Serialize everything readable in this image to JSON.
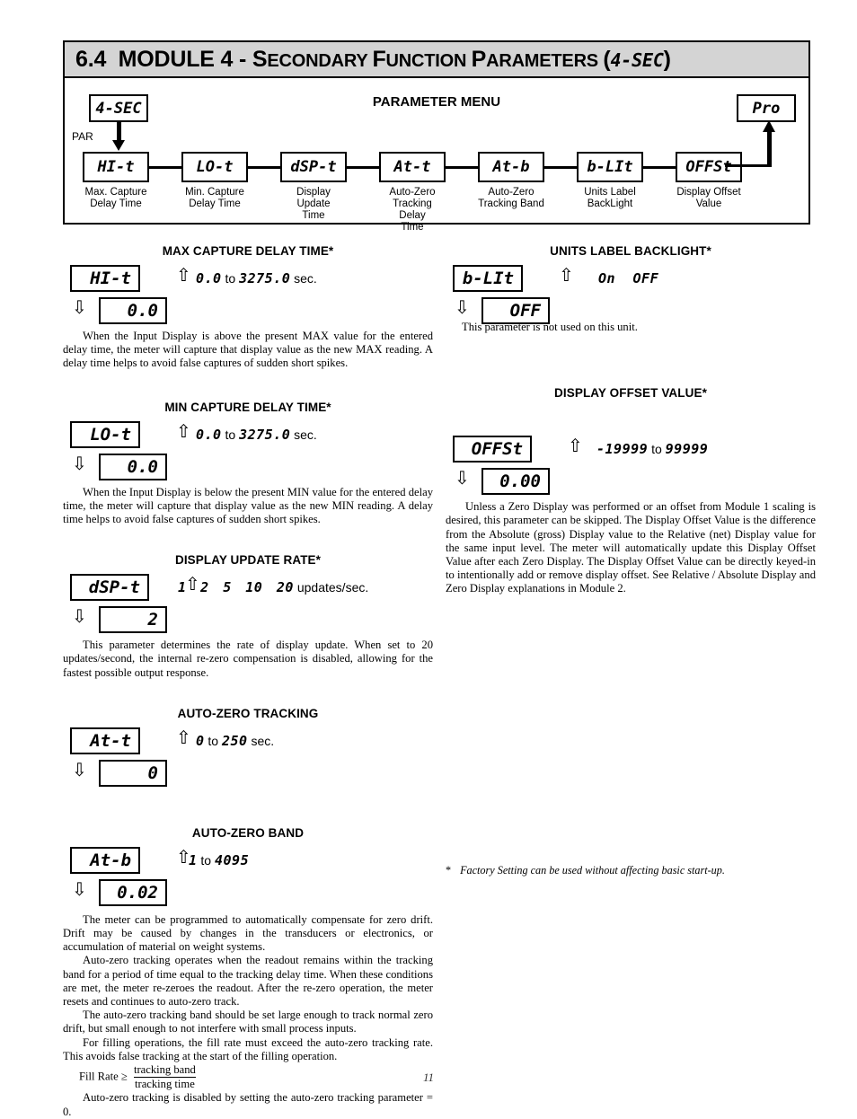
{
  "header": {
    "section_number": "6.4",
    "title_main": "MODULE 4 - ",
    "title_rest_s": "S",
    "title_rest_econdary": "ECONDARY ",
    "title_rest_f": "F",
    "title_rest_unction": "UNCTION ",
    "title_rest_p": "P",
    "title_rest_arameters": "ARAMETERS ",
    "title_paren_open": "(",
    "title_code": "4-SEC",
    "title_paren_close": ")"
  },
  "menu": {
    "title": "PARAMETER MENU",
    "start_code": "4-SEC",
    "end_code": "Pro",
    "par_label": "PAR",
    "nodes": [
      {
        "code": "HI-t",
        "caption": "Max. Capture\nDelay Time"
      },
      {
        "code": "LO-t",
        "caption": "Min. Capture\nDelay Time"
      },
      {
        "code": "dSP-t",
        "caption": "Display Update\nTime"
      },
      {
        "code": "At-t",
        "caption": "Auto-Zero\nTracking Delay\nTime"
      },
      {
        "code": "At-b",
        "caption": "Auto-Zero\nTracking Band"
      },
      {
        "code": "b-LIt",
        "caption": "Units Label\nBackLight"
      },
      {
        "code": "OFFSt",
        "caption": "Display Offset\nValue"
      }
    ]
  },
  "sections": {
    "max_capture": {
      "heading": "MAX CAPTURE DELAY TIME*",
      "param_code": "HI-t",
      "value": "0.0",
      "range_min": "0.0",
      "range_sep": " to ",
      "range_max": "3275.0",
      "range_unit": " sec.",
      "body": "When the Input Display is above the present MAX value for the entered delay time, the meter will capture that display value as the new MAX reading. A delay time helps to avoid false captures of sudden short spikes."
    },
    "min_capture": {
      "heading": "MIN CAPTURE DELAY TIME*",
      "param_code": "LO-t",
      "value": "0.0",
      "range_min": "0.0",
      "range_sep": " to ",
      "range_max": "3275.0",
      "range_unit": " sec.",
      "body": "When the Input Display is below the present MIN value for the entered delay time, the meter will capture that display value as the new MIN reading. A delay time helps to avoid false captures of sudden short spikes."
    },
    "display_update": {
      "heading": "DISPLAY UPDATE RATE*",
      "param_code": "dSP-t",
      "value": "2",
      "options": [
        "1",
        "2",
        "5",
        "10",
        "20"
      ],
      "range_unit": " updates/sec.",
      "body": "This parameter determines the rate of display update. When set to 20 updates/second, the internal re-zero compensation is disabled, allowing for the fastest possible output response."
    },
    "auto_zero_tracking": {
      "heading": "AUTO-ZERO TRACKING",
      "param_code": "At-t",
      "value": "0",
      "range_min": "0",
      "range_sep": " to ",
      "range_max": "250",
      "range_unit": " sec."
    },
    "auto_zero_band": {
      "heading": "AUTO-ZERO BAND",
      "param_code": "At-b",
      "value": "0.02",
      "range_min": "1",
      "range_sep": " to ",
      "range_max": "4095",
      "range_unit": ""
    },
    "auto_zero_body": {
      "p1": "The meter can be programmed to automatically compensate for zero drift. Drift may be caused by changes in the transducers or electronics, or accumulation of material on weight systems.",
      "p2": "Auto-zero tracking operates when the readout remains within the tracking band for a period of time equal to the tracking delay time. When these conditions are met, the meter re-zeroes the readout. After the re-zero operation, the meter resets and continues to auto-zero track.",
      "p3": "The auto-zero tracking band should be set large enough to track normal zero drift, but small enough to not interfere with small process inputs.",
      "p4": "For filling operations, the fill rate must exceed the auto-zero tracking rate. This avoids false tracking at the start of the filling operation.",
      "fill_rate_label": "Fill Rate",
      "fill_rate_op": "≥",
      "fill_rate_numerator": "tracking band",
      "fill_rate_denominator": "tracking time",
      "p5": "Auto-zero tracking is disabled by setting the auto-zero tracking parameter = 0."
    },
    "units_backlight": {
      "heading": "UNITS LABEL BACKLIGHT*",
      "param_code": "b-LIt",
      "value": "OFF",
      "option_on": "On",
      "option_off": "OFF",
      "body": "This parameter is not used on this unit."
    },
    "display_offset": {
      "heading": "DISPLAY OFFSET VALUE*",
      "param_code": "OFFSt",
      "value": "0.00",
      "range_min": "-19999",
      "range_sep": " to ",
      "range_max": "99999",
      "body": "Unless a Zero Display was performed or an offset from Module 1 scaling is desired, this parameter can be skipped. The Display Offset Value is the difference from the Absolute (gross) Display value to the Relative (net) Display value for the same input level. The meter will automatically update this Display Offset Value after each Zero Display. The Display Offset Value can be directly keyed-in to intentionally add or remove display offset. See Relative / Absolute Display and Zero Display explanations in Module 2."
    }
  },
  "footnote": {
    "marker": "*",
    "text": "Factory Setting can be used without affecting basic start-up."
  },
  "page_number": "11"
}
